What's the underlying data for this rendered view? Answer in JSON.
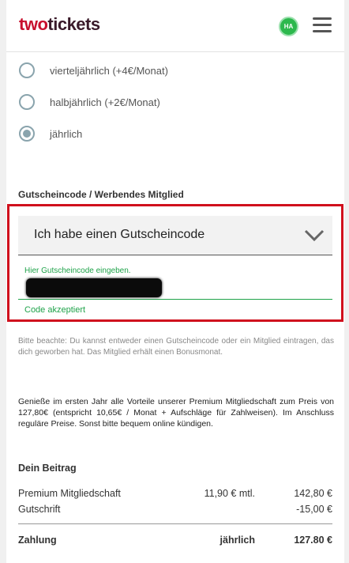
{
  "header": {
    "logo_part1": "two",
    "logo_part2": "tickets",
    "avatar_initials": "HA"
  },
  "payment_options": [
    {
      "label": "vierteljährlich (+4€/Monat)",
      "selected": false
    },
    {
      "label": "halbjährlich (+2€/Monat)",
      "selected": false
    },
    {
      "label": "jährlich",
      "selected": true
    }
  ],
  "voucher": {
    "section_label": "Gutscheincode / Werbendes Mitglied",
    "select_value": "Ich habe einen Gutscheincode",
    "input_hint": "Hier Gutscheincode eingeben.",
    "status": "Code akzeptiert"
  },
  "note": "Bitte beachte: Du kannst entweder einen Gutscheincode oder ein Mitglied eintragen, das dich geworben hat. Das Mitglied erhält einen Bonusmonat.",
  "promo": "Genieße im ersten Jahr alle Vorteile unserer Premium Mitgliedschaft zum Preis von 127,80€ (entspricht 10,65€ / Monat + Aufschläge für Zahlweisen). Im Anschluss reguläre Preise. Sonst bitte bequem online kündigen.",
  "beitrag": {
    "title": "Dein Beitrag",
    "rows": [
      {
        "name": "Premium Mitgliedschaft",
        "monthly": "11,90 € mtl.",
        "amount": "142,80 €"
      },
      {
        "name": "Gutschrift",
        "monthly": "",
        "amount": "-15,00 €"
      }
    ],
    "total": {
      "name": "Zahlung",
      "period": "jährlich",
      "amount": "127.80 €"
    }
  },
  "colors": {
    "brand_red": "#c8102e",
    "highlight_red": "#d0101d",
    "success_green": "#1fa34a",
    "avatar_green": "#2db84d"
  }
}
